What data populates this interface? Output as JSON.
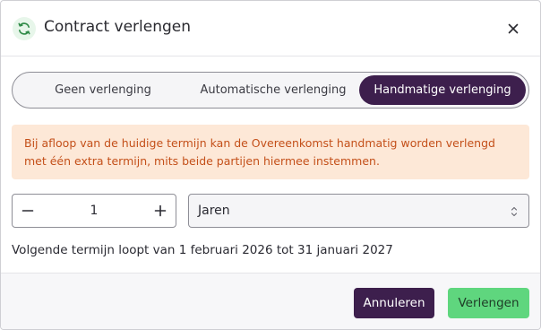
{
  "dialog": {
    "title": "Contract verlengen",
    "header_icon": "refresh-icon",
    "close_icon": "close-icon"
  },
  "renewal_options": {
    "options": [
      "Geen verlenging",
      "Automatische verlenging",
      "Handmatige verlenging"
    ],
    "selected": "Handmatige verlenging"
  },
  "alert": {
    "text": "Bij afloop van de huidige termijn kan de Overeenkomst handmatig worden verlengd met één extra termijn, mits beide partijen hiermee instemmen."
  },
  "term": {
    "quantity": "1",
    "unit": "Jaren",
    "minus_icon": "minus-icon",
    "plus_icon": "plus-icon",
    "select_icon": "chevron-up-down-icon"
  },
  "next_term_text": "Volgende termijn loopt van 1 februari 2026 tot 31 januari 2027",
  "footer": {
    "cancel_label": "Annuleren",
    "confirm_label": "Verlengen"
  },
  "colors": {
    "primary": "#3d1f4d",
    "confirm": "#5fd67e",
    "alert_bg": "#fde8d7",
    "alert_text": "#c4501a",
    "icon_green": "#2f8a47"
  }
}
